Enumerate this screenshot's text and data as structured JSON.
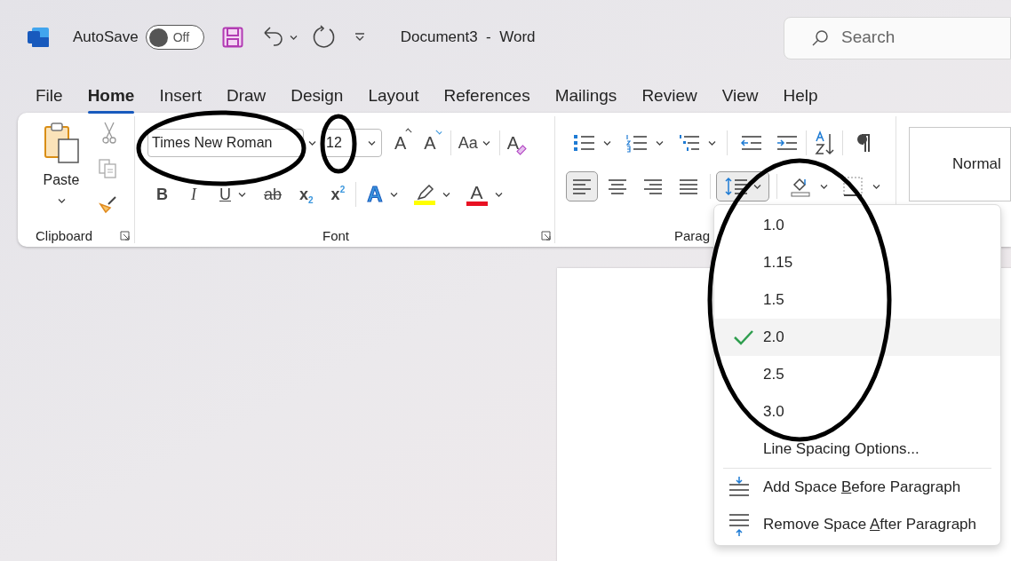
{
  "title_bar": {
    "autosave_label": "AutoSave",
    "autosave": {
      "on": false,
      "label": "Off"
    },
    "document_title": "Document3  -  Word",
    "search": {
      "placeholder": "Search"
    }
  },
  "tabs": [
    {
      "label": "File",
      "selected": false
    },
    {
      "label": "Home",
      "selected": true
    },
    {
      "label": "Insert",
      "selected": false
    },
    {
      "label": "Draw",
      "selected": false
    },
    {
      "label": "Design",
      "selected": false
    },
    {
      "label": "Layout",
      "selected": false
    },
    {
      "label": "References",
      "selected": false
    },
    {
      "label": "Mailings",
      "selected": false
    },
    {
      "label": "Review",
      "selected": false
    },
    {
      "label": "View",
      "selected": false
    },
    {
      "label": "Help",
      "selected": false
    }
  ],
  "ribbon": {
    "clipboard": {
      "paste_label": "Paste",
      "group_label": "Clipboard"
    },
    "font": {
      "font_name": "Times New Roman",
      "font_size": "12",
      "group_label": "Font",
      "row_1": [
        {
          "kind": "grow",
          "glyph": "A"
        },
        {
          "kind": "shrink",
          "glyph": "A"
        },
        {
          "kind": "case",
          "glyph": "Aa"
        },
        {
          "kind": "clear",
          "glyph": "A"
        }
      ],
      "row_2": [
        {
          "kind": "bold",
          "glyph": "B"
        },
        {
          "kind": "italic",
          "glyph": "I"
        },
        {
          "kind": "underline",
          "glyph": "U"
        },
        {
          "kind": "strike",
          "glyph": "ab"
        },
        {
          "kind": "subscript",
          "glyph": "x",
          "index": "2"
        },
        {
          "kind": "superscript",
          "glyph": "x",
          "index": "2"
        },
        {
          "kind": "effects",
          "glyph": "A"
        },
        {
          "kind": "highlight",
          "color": "#ffff00"
        },
        {
          "kind": "font-color",
          "glyph": "A",
          "color": "#e81123"
        }
      ]
    },
    "paragraph": {
      "group_label": "Parag",
      "alignment": [
        {
          "kind": "left",
          "selected": true
        },
        {
          "kind": "center",
          "selected": false
        },
        {
          "kind": "right",
          "selected": false
        },
        {
          "kind": "justify",
          "selected": false
        }
      ],
      "line_spacing_expanded": true
    },
    "styles": {
      "items": [
        {
          "label": "Normal"
        }
      ]
    }
  },
  "line_spacing_menu": {
    "options": [
      {
        "label": "1.0",
        "checked": false
      },
      {
        "label": "1.15",
        "checked": false
      },
      {
        "label": "1.5",
        "checked": false
      },
      {
        "label": "2.0",
        "checked": true
      },
      {
        "label": "2.5",
        "checked": false
      },
      {
        "label": "3.0",
        "checked": false
      }
    ],
    "more": "Line Spacing Options...",
    "actions": [
      {
        "kind": "add-before",
        "before": "Add Space ",
        "key": "B",
        "after": "efore Paragraph"
      },
      {
        "kind": "remove-after",
        "before": "Remove Space ",
        "key": "A",
        "after": "fter Paragraph"
      }
    ]
  },
  "annotations": [
    {
      "kind": "ellipse"
    },
    {
      "kind": "ellipse"
    },
    {
      "kind": "ellipse"
    }
  ]
}
